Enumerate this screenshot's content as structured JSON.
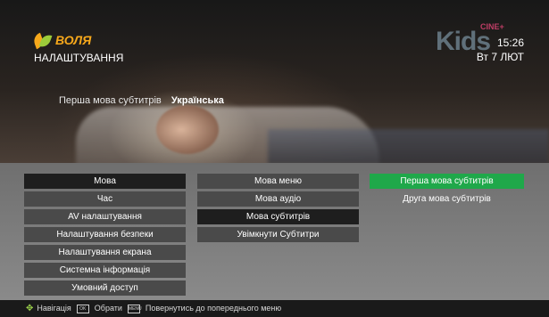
{
  "header": {
    "brand": "ВОЛЯ",
    "title": "НАЛАШТУВАННЯ",
    "channel": "Kids",
    "channel_sub": "CINE+",
    "time": "15:26",
    "date": "Вт 7 ЛЮТ"
  },
  "current": {
    "label": "Перша мова субтитрів",
    "value": "Українська"
  },
  "menu": {
    "column1": [
      {
        "label": "Мова",
        "state": "selected"
      },
      {
        "label": "Час",
        "state": ""
      },
      {
        "label": "AV налаштування",
        "state": ""
      },
      {
        "label": "Налаштування безпеки",
        "state": ""
      },
      {
        "label": "Налаштування екрана",
        "state": ""
      },
      {
        "label": "Системна інформація",
        "state": ""
      },
      {
        "label": "Умовний доступ",
        "state": ""
      }
    ],
    "column2": [
      {
        "label": "Мова меню",
        "state": ""
      },
      {
        "label": "Мова аудіо",
        "state": ""
      },
      {
        "label": "Мова субтитрів",
        "state": "selected"
      },
      {
        "label": "Увімкнути Субтитри",
        "state": ""
      }
    ],
    "column3": [
      {
        "label": "Перша мова субтитрів",
        "state": "focus"
      },
      {
        "label": "Друга мова субтитрів",
        "state": ""
      }
    ]
  },
  "footer": {
    "navigate": "Навігація",
    "ok_key": "OK",
    "select": "Обрати",
    "back_key": "MENU",
    "back": "Повернутись до попереднього меню"
  },
  "colors": {
    "accent": "#1fa84a",
    "brand": "#f7a81b"
  }
}
